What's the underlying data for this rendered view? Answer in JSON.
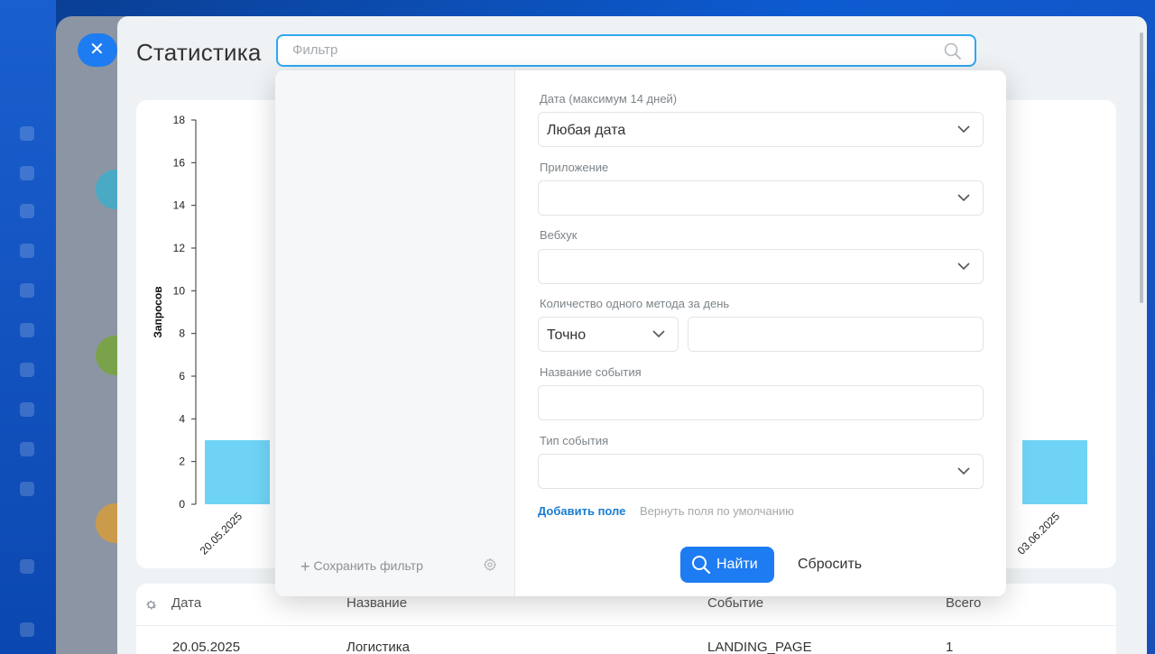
{
  "page": {
    "title": "Статистика"
  },
  "filter": {
    "placeholder": "Фильтр"
  },
  "chart_data": {
    "type": "bar",
    "ylabel": "Запросов",
    "xlabel": "",
    "ylim": [
      0,
      18
    ],
    "yticks": [
      0,
      2,
      4,
      6,
      8,
      10,
      12,
      14,
      16,
      18
    ],
    "categories": [
      "20.05.2025",
      "03.06.2025"
    ],
    "values": [
      3,
      3
    ],
    "colors": {
      "bar": "#6fd3f5"
    },
    "grid": false
  },
  "popup": {
    "save_filter": "Сохранить фильтр",
    "fields": {
      "date": {
        "label": "Дата (максимум 14 дней)",
        "value": "Любая дата"
      },
      "app": {
        "label": "Приложение",
        "value": ""
      },
      "webhook": {
        "label": "Вебхук",
        "value": ""
      },
      "count": {
        "label": "Количество одного метода за день",
        "mode": "Точно",
        "value": ""
      },
      "event_name": {
        "label": "Название события",
        "value": ""
      },
      "event_type": {
        "label": "Тип события",
        "value": ""
      }
    },
    "add_field": "Добавить поле",
    "reset_fields": "Вернуть поля по умолчанию",
    "find": "Найти",
    "reset": "Сбросить"
  },
  "table": {
    "columns": [
      "Дата",
      "Название",
      "Событие",
      "Всего"
    ],
    "rows": [
      {
        "date": "20.05.2025",
        "name": "Логистика",
        "event": "LANDING_PAGE",
        "total": "1"
      }
    ]
  },
  "colors": {
    "accent": "#1e7cf2",
    "focus": "#2fa8f0",
    "bar": "#6fd3f5"
  }
}
